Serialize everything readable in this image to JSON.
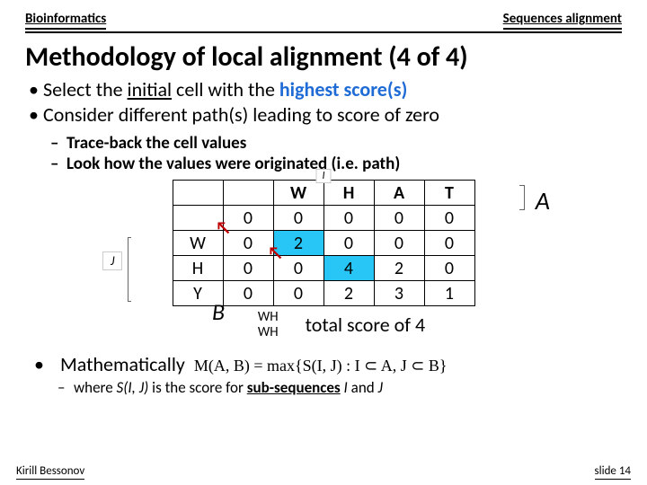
{
  "header": {
    "left": "Bioinformatics",
    "right": "Sequences alignment"
  },
  "title": "Methodology of local alignment (4 of 4)",
  "bullets": {
    "b1_pre": "Select the ",
    "b1_underlined": "initial",
    "b1_mid": " cell with the ",
    "b1_highlight": "highest score(s)",
    "b2": "Consider different path(s) leading to score of zero"
  },
  "sub_bullets": {
    "s1": "Trace-back the cell values",
    "s2": "Look  how the values were originated (i.e. path)"
  },
  "labels": {
    "i": "I",
    "j": "J",
    "A": "A",
    "B": "B"
  },
  "matrix": {
    "col_heads": [
      "",
      "",
      "W",
      "H",
      "A",
      "T"
    ],
    "rows": [
      {
        "head": "",
        "cells": [
          "0",
          "0",
          "0",
          "0",
          "0"
        ]
      },
      {
        "head": "W",
        "cells": [
          "0",
          "2",
          "0",
          "0",
          "0"
        ]
      },
      {
        "head": "H",
        "cells": [
          "0",
          "0",
          "4",
          "2",
          "0"
        ]
      },
      {
        "head": "Y",
        "cells": [
          "0",
          "0",
          "2",
          "3",
          "1"
        ]
      }
    ],
    "path": [
      [
        1,
        1
      ],
      [
        2,
        2
      ]
    ]
  },
  "wh": {
    "l1": "WH",
    "l2": "WH"
  },
  "score_line": "total score of 4",
  "math": {
    "label": "Mathematically",
    "formula": "M(A, B) = max{S(I, J) : I ⊂ A, J ⊂ B}"
  },
  "where": {
    "pre": "where ",
    "sij": "S(I, J)",
    "mid": " is the score for ",
    "bold": "sub-sequences",
    "i": " I",
    "and": " and ",
    "j": "J"
  },
  "footer": {
    "left": "Kirill Bessonov",
    "right": "slide 14"
  },
  "chart_data": {
    "type": "table",
    "title": "Local alignment DP matrix (sequence A vs B)",
    "x_labels": [
      "",
      "W",
      "H",
      "A",
      "T"
    ],
    "y_labels": [
      "",
      "W",
      "H",
      "Y"
    ],
    "values": [
      [
        0,
        0,
        0,
        0,
        0
      ],
      [
        0,
        2,
        0,
        0,
        0
      ],
      [
        0,
        0,
        4,
        2,
        0
      ],
      [
        0,
        0,
        2,
        3,
        1
      ]
    ],
    "traceback_path_cells": [
      [
        2,
        2
      ],
      [
        1,
        1
      ]
    ],
    "best_score": 4,
    "aligned_A": "WH",
    "aligned_B": "WH"
  }
}
